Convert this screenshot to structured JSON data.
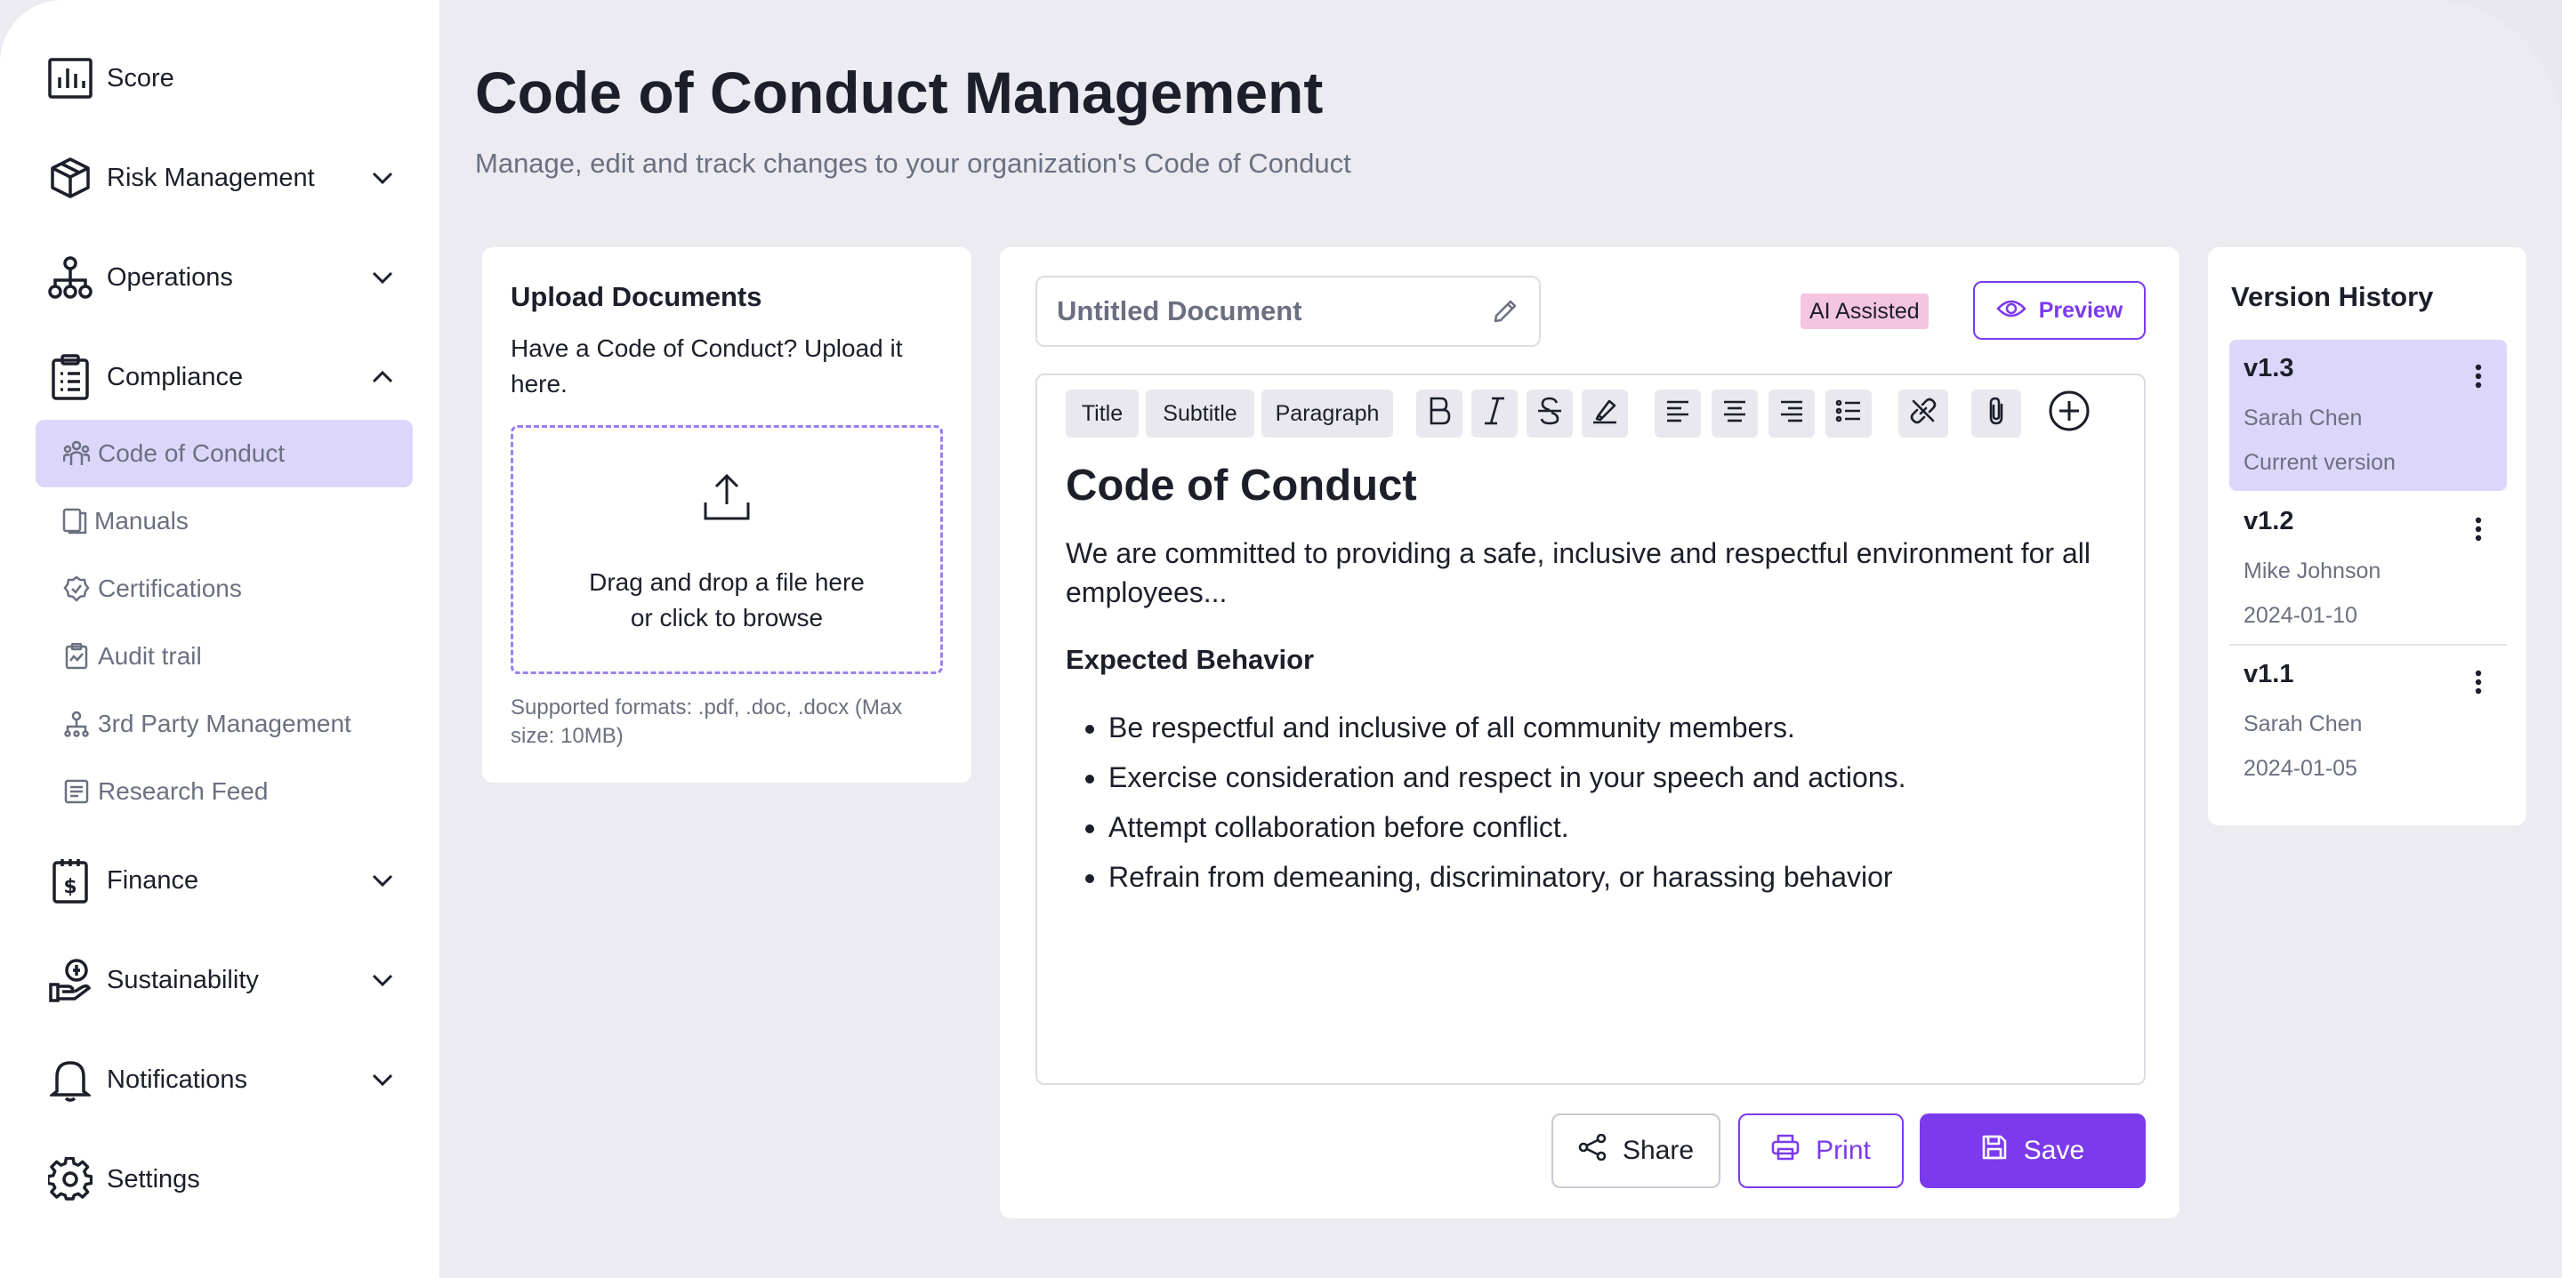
{
  "sidebar": {
    "items": [
      {
        "label": "Score",
        "icon": "chart-bar-icon"
      },
      {
        "label": "Risk Management",
        "icon": "cube-icon"
      },
      {
        "label": "Operations",
        "icon": "network-icon"
      },
      {
        "label": "Compliance",
        "icon": "clipboard-icon"
      }
    ],
    "compliance_sub": [
      {
        "label": "Code of Conduct",
        "icon": "people-icon",
        "active": true
      },
      {
        "label": "Manuals",
        "icon": "book-icon"
      },
      {
        "label": "Certifications",
        "icon": "badge-icon"
      },
      {
        "label": "Audit trail",
        "icon": "audit-icon"
      },
      {
        "label": "3rd Party Management",
        "icon": "hierarchy-icon"
      },
      {
        "label": "Research Feed",
        "icon": "feed-icon"
      }
    ],
    "items_after": [
      {
        "label": "Finance",
        "icon": "finance-icon"
      },
      {
        "label": "Sustainability",
        "icon": "sustainability-icon"
      },
      {
        "label": "Notifications",
        "icon": "bell-icon"
      },
      {
        "label": "Settings",
        "icon": "gear-icon"
      }
    ]
  },
  "header": {
    "title": "Code of Conduct Management",
    "subtitle": "Manage, edit and track changes to your organization's Code of Conduct"
  },
  "upload": {
    "title": "Upload Documents",
    "description": "Have a Code of Conduct? Upload it here.",
    "drop_line1": "Drag and drop a file here",
    "drop_line2": "or click to browse",
    "formats": "Supported formats: .pdf, .doc, .docx (Max size: 10MB)"
  },
  "editor": {
    "doc_title": "Untitled Document",
    "ai_badge": "AI Assisted",
    "preview_label": "Preview",
    "toolbar": {
      "title": "Title",
      "subtitle": "Subtitle",
      "paragraph": "Paragraph"
    },
    "content": {
      "heading": "Code of Conduct",
      "intro": "We are committed to providing a safe, inclusive and respectful environment for all employees...",
      "section": "Expected Behavior",
      "bullets": [
        "Be respectful and inclusive of all community members.",
        "Exercise consideration and respect in your speech and actions.",
        "Attempt collaboration before conflict.",
        "Refrain from demeaning, discriminatory, or harassing behavior"
      ]
    },
    "actions": {
      "share": "Share",
      "print": "Print",
      "save": "Save"
    },
    "colors": {
      "accent": "#7c3aed",
      "active_bg": "#ddd6fb",
      "ai_badge_bg": "#f4c5e0"
    }
  },
  "versions": {
    "title": "Version History",
    "items": [
      {
        "version": "v1.3",
        "author": "Sarah Chen",
        "meta": "Current version",
        "active": true
      },
      {
        "version": "v1.2",
        "author": "Mike Johnson",
        "meta": "2024-01-10"
      },
      {
        "version": "v1.1",
        "author": "Sarah Chen",
        "meta": "2024-01-05"
      }
    ]
  }
}
